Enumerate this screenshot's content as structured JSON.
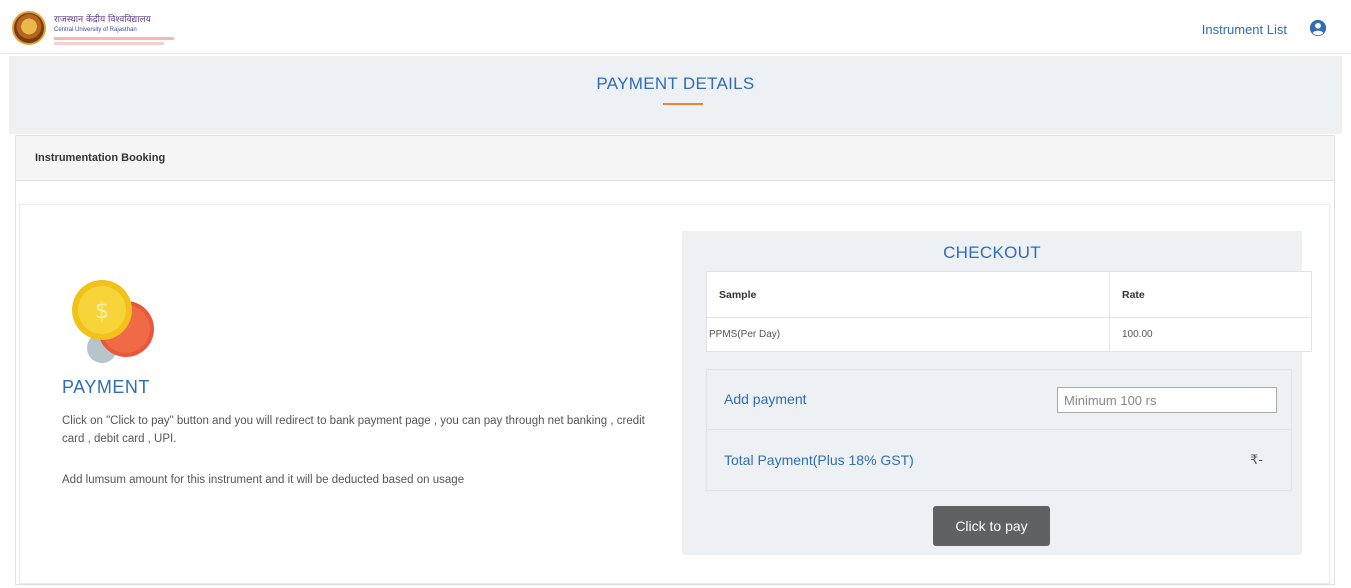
{
  "header": {
    "logo_line1": "राजस्थान केंद्रीय विश्वविद्यालय",
    "logo_line2": "Central University of Rajasthan",
    "nav_link": "Instrument List",
    "user_icon": "user-circle-icon"
  },
  "title": "PAYMENT DETAILS",
  "panel": {
    "heading": "Instrumentation Booking"
  },
  "payment_info": {
    "icon": "coin-icon",
    "coin_symbol": "$",
    "heading": "PAYMENT",
    "description": "Click on \"Click to pay\" button and you will redirect to bank payment page , you can pay through net banking , credit card , debit card , UPI.",
    "note": "Add lumsum amount for this instrument and it will be deducted based on usage"
  },
  "checkout": {
    "title": "CHECKOUT",
    "columns": [
      "Sample",
      "Rate"
    ],
    "rows": [
      {
        "sample": "PPMS(Per Day)",
        "rate": "100.00"
      }
    ],
    "add_payment_label": "Add payment",
    "add_payment_placeholder": "Minimum 100 rs",
    "total_label": "Total Payment(Plus 18% GST)",
    "total_value": "₹-",
    "pay_button": "Click to pay"
  },
  "colors": {
    "accent": "#2f6db5",
    "underline": "#f0803c",
    "button": "#5f6263",
    "band": "#eef1f4"
  }
}
